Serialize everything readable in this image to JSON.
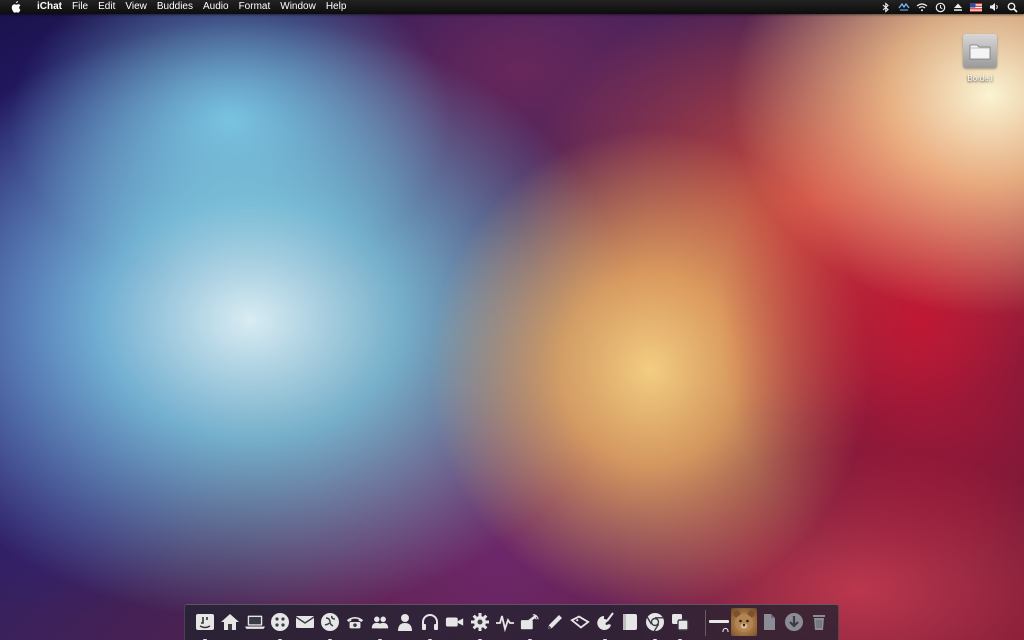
{
  "menubar": {
    "apple_icon": "apple-logo",
    "items": [
      "iChat",
      "File",
      "Edit",
      "View",
      "Buddies",
      "Audio",
      "Format",
      "Window",
      "Help"
    ],
    "status_icons": [
      "bluetooth-icon",
      "dropbox-icon",
      "wifi-icon",
      "time-machine-icon",
      "eject-icon",
      "flag-us-icon",
      "volume-icon",
      "spotlight-icon"
    ]
  },
  "desktop": {
    "folder_label": "Borde.l"
  },
  "dock": {
    "apps": [
      "finder-icon",
      "home-icon",
      "laptop-icon",
      "dashboard-icon",
      "mail-icon",
      "safari-icon",
      "phone-icon",
      "contacts-icon",
      "person-icon",
      "headphones-icon",
      "facetime-icon",
      "settings-gear-icon",
      "activity-monitor-icon",
      "broadcast-icon",
      "pencil-icon",
      "tags-icon",
      "paint-icon",
      "notes-icon",
      "chrome-icon",
      "spaces-icon"
    ],
    "stacks": [
      "documents-stack-icon",
      "downloads-stack-icon",
      "trash-icon"
    ]
  }
}
